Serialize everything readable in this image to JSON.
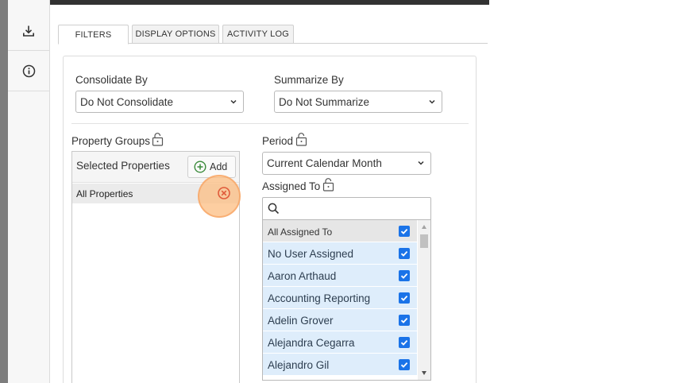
{
  "rail": {
    "download_icon": "download-icon",
    "info_icon": "info-icon"
  },
  "tabs": [
    {
      "label": "FILTERS",
      "active": true
    },
    {
      "label": "DISPLAY OPTIONS",
      "active": false
    },
    {
      "label": "ACTIVITY LOG",
      "active": false
    }
  ],
  "consolidate": {
    "label": "Consolidate By",
    "value": "Do Not Consolidate"
  },
  "summarize": {
    "label": "Summarize By",
    "value": "Do Not Summarize"
  },
  "property_groups": {
    "label": "Property Groups",
    "selected_title": "Selected Properties",
    "add_label": "Add",
    "items": [
      "All Properties"
    ]
  },
  "period": {
    "label": "Period",
    "value": "Current Calendar Month"
  },
  "assigned_to": {
    "label": "Assigned To",
    "search_value": "",
    "items": [
      {
        "label": "All Assigned To",
        "checked": true
      },
      {
        "label": "No User Assigned",
        "checked": true
      },
      {
        "label": "Aaron Arthaud",
        "checked": true
      },
      {
        "label": "Accounting Reporting",
        "checked": true
      },
      {
        "label": "Adelin Grover",
        "checked": true
      },
      {
        "label": "Alejandra Cegarra",
        "checked": true
      },
      {
        "label": "Alejandro Gil",
        "checked": true
      }
    ]
  },
  "colors": {
    "accent": "#1a73e8",
    "highlight": "#fcbe82",
    "remove": "#e05a3a",
    "add": "#3a8a3a",
    "topbar": "#323232"
  }
}
